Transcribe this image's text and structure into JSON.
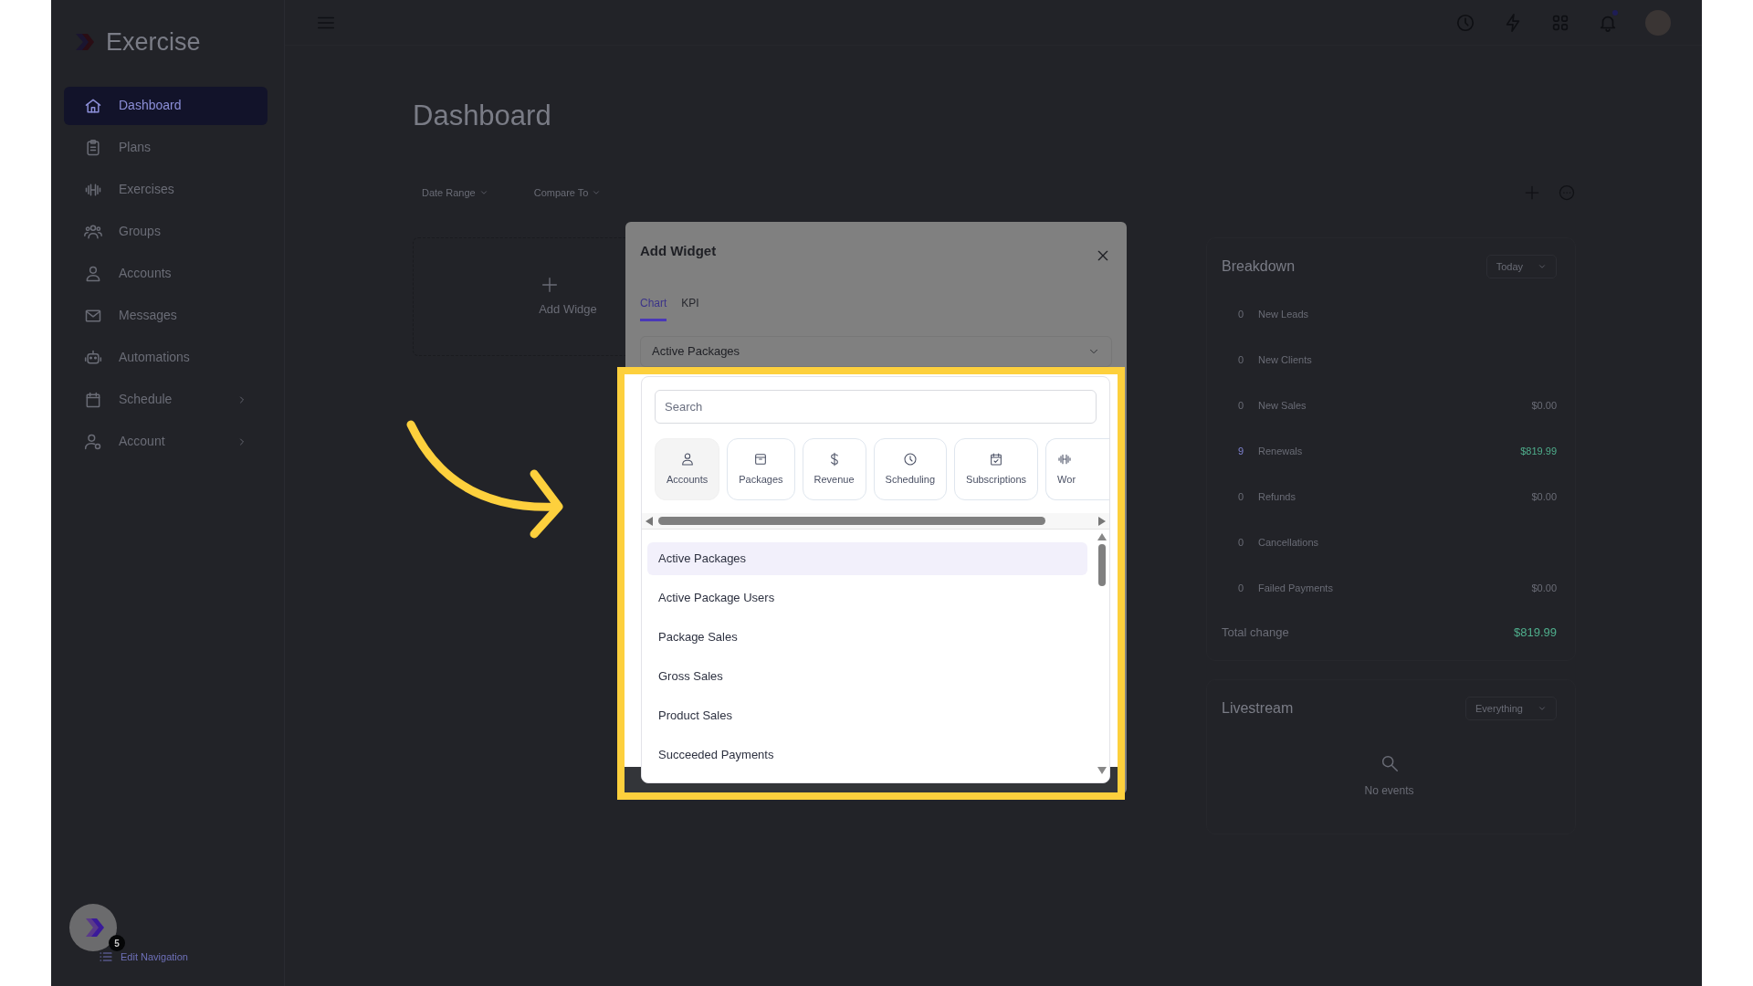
{
  "app": {
    "brand": "Exercise"
  },
  "sidebar": {
    "items": [
      {
        "label": "Dashboard",
        "selected": true,
        "expandable": false
      },
      {
        "label": "Plans",
        "selected": false,
        "expandable": false
      },
      {
        "label": "Exercises",
        "selected": false,
        "expandable": false
      },
      {
        "label": "Groups",
        "selected": false,
        "expandable": false
      },
      {
        "label": "Accounts",
        "selected": false,
        "expandable": false
      },
      {
        "label": "Messages",
        "selected": false,
        "expandable": false
      },
      {
        "label": "Automations",
        "selected": false,
        "expandable": false
      },
      {
        "label": "Schedule",
        "selected": false,
        "expandable": true
      },
      {
        "label": "Account",
        "selected": false,
        "expandable": true
      }
    ],
    "badge": "5",
    "edit_navigation": "Edit Navigation"
  },
  "page": {
    "title": "Dashboard",
    "filters": [
      "Date Range",
      "Compare To"
    ],
    "add_widget": "Add Widge"
  },
  "breakdown": {
    "title": "Breakdown",
    "period": "Today",
    "rows": [
      {
        "count": "0",
        "label": "New Leads",
        "highlighted": false
      },
      {
        "count": "0",
        "label": "New Clients",
        "highlighted": false
      },
      {
        "count": "0",
        "label": "New Sales",
        "amount": "$0.00",
        "highlighted": false
      },
      {
        "count": "9",
        "label": "Renewals",
        "amount": "$819.99",
        "highlighted": true
      },
      {
        "count": "0",
        "label": "Refunds",
        "amount": "$0.00",
        "highlighted": false
      },
      {
        "count": "0",
        "label": "Cancellations",
        "highlighted": false
      },
      {
        "count": "0",
        "label": "Failed Payments",
        "amount": "$0.00",
        "highlighted": false
      }
    ],
    "total_label": "Total change",
    "total": "$819.99"
  },
  "livestream": {
    "title": "Livestream",
    "filter": "Everything",
    "empty_text": "No events"
  },
  "modal": {
    "title": "Add Widget",
    "tabs": [
      {
        "label": "Chart",
        "selected": true
      },
      {
        "label": "KPI",
        "selected": false
      }
    ],
    "select_value": "Active Packages",
    "dropdown": {
      "search": {
        "placeholder": "Search"
      },
      "categories": [
        {
          "label": "Accounts",
          "selected": true
        },
        {
          "label": "Packages",
          "selected": false
        },
        {
          "label": "Revenue",
          "selected": false
        },
        {
          "label": "Scheduling",
          "selected": false
        },
        {
          "label": "Subscriptions",
          "selected": false
        },
        {
          "label": "Wor",
          "selected": false
        }
      ],
      "options": [
        {
          "label": "Active Packages",
          "selected": true
        },
        {
          "label": "Active Package Users",
          "selected": false
        },
        {
          "label": "Package Sales",
          "selected": false
        },
        {
          "label": "Gross Sales",
          "selected": false
        },
        {
          "label": "Product Sales",
          "selected": false
        },
        {
          "label": "Succeeded Payments",
          "selected": false
        }
      ]
    }
  }
}
